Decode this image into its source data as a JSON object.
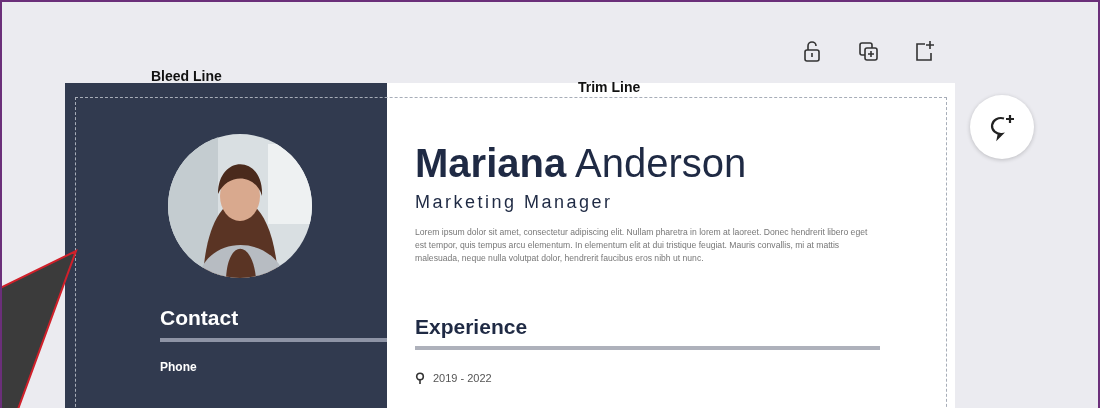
{
  "guides": {
    "bleed_label": "Bleed Line",
    "trim_label": "Trim Line"
  },
  "resume": {
    "name": "**Mariana** Anderson",
    "title": "Marketing Manager",
    "summary": "Lorem ipsum dolor sit amet, consectetur adipiscing elit. Nullam pharetra in lorem at laoreet. Donec hendrerit libero eget est tempor, quis tempus arcu elementum. In elementum elit at dui tristique feugiat. Mauris convallis, mi at mattis malesuada, neque nulla volutpat dolor, hendrerit faucibus eros nibh ut nunc.",
    "contact": {
      "heading": "Contact",
      "fields": [
        {
          "label": "Phone"
        }
      ]
    },
    "experience": {
      "heading": "Experience",
      "entries": [
        {
          "dates": "2019 - 2022"
        }
      ]
    }
  }
}
